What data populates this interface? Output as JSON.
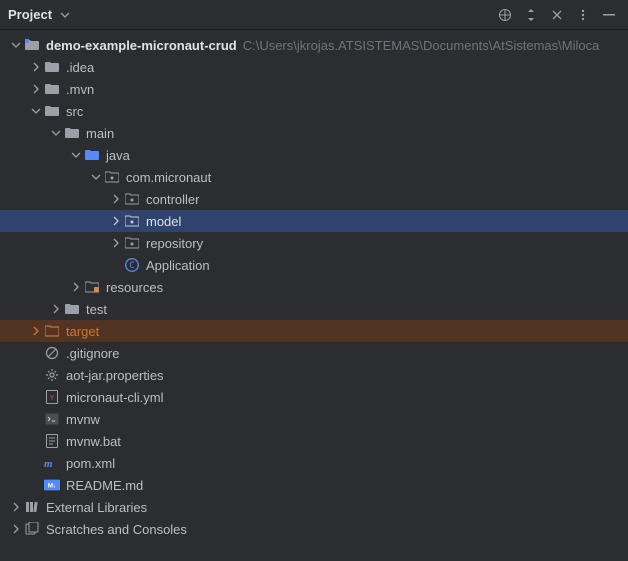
{
  "header": {
    "title": "Project"
  },
  "tree": {
    "root": {
      "name": "demo-example-micronaut-crud",
      "path_hint": "C:\\Users\\jkrojas.ATSISTEMAS\\Documents\\AtSistemas\\Miloca"
    },
    "items": {
      "idea": ".idea",
      "mvn": ".mvn",
      "src": "src",
      "main": "main",
      "java": "java",
      "pkg": "com.micronaut",
      "controller": "controller",
      "model": "model",
      "repository": "repository",
      "application": "Application",
      "resources": "resources",
      "test": "test",
      "target": "target",
      "gitignore": ".gitignore",
      "aot": "aot-jar.properties",
      "cli": "micronaut-cli.yml",
      "mvnw": "mvnw",
      "mvnwbat": "mvnw.bat",
      "pom": "pom.xml",
      "readme": "README.md",
      "extlib": "External Libraries",
      "scratches": "Scratches and Consoles"
    }
  }
}
